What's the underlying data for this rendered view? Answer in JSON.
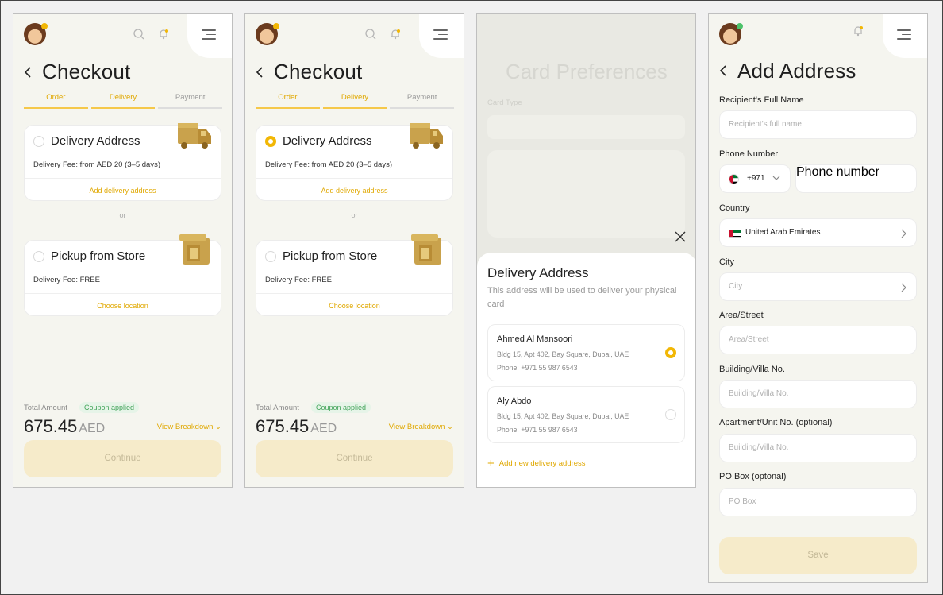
{
  "checkout": {
    "title": "Checkout",
    "steps": [
      "Order",
      "Delivery",
      "Payment"
    ],
    "delivery_card": {
      "title": "Delivery Address",
      "fee": "Delivery Fee: from AED 20 (3–5 days)",
      "link": "Add delivery address"
    },
    "or_text": "or",
    "pickup_card": {
      "title": "Pickup from Store",
      "fee": "Delivery Fee: FREE",
      "link": "Choose location"
    },
    "total_label": "Total Amount",
    "coupon": "Coupon applied",
    "amount": "675.45",
    "currency": "AED",
    "breakdown": "View Breakdown",
    "continue": "Continue"
  },
  "card_preferences": {
    "bg_title": "Card Preferences",
    "bg_label": "Card Type",
    "sheet": {
      "title": "Delivery Address",
      "subtitle": "This address will be used to deliver your physical card",
      "addresses": [
        {
          "name": "Ahmed Al Mansoori",
          "line1": "Bldg 15, Apt 402, Bay Square, Dubai, UAE",
          "phone": "Phone: +971 55 987 6543",
          "selected": true
        },
        {
          "name": "Aly Abdo",
          "line1": "Bldg 15, Apt 402, Bay Square, Dubai, UAE",
          "phone": "Phone: +971 55 987 6543",
          "selected": false
        }
      ],
      "add_new": "Add new delivery address"
    }
  },
  "add_address": {
    "title": "Add Address",
    "recipient_label": "Recipient's Full Name",
    "recipient_placeholder": "Recipient's full name",
    "phone_label": "Phone Number",
    "phone_code": "+971",
    "phone_placeholder": "Phone number",
    "country_label": "Country",
    "country_value": "United Arab Emirates",
    "city_label": "City",
    "city_placeholder": "City",
    "street_label": "Area/Street",
    "street_placeholder": "Area/Street",
    "building_label": "Building/Villa No.",
    "building_placeholder": "Building/Villa No.",
    "apartment_label": "Apartment/Unit No. (optional)",
    "apartment_placeholder": "Building/Villa No.",
    "pobox_label": "PO Box (optonal)",
    "pobox_placeholder": "PO Box",
    "save": "Save"
  },
  "colors": {
    "accent": "#f2b705",
    "accent_text": "#e0a800",
    "button_disabled": "#f6ebca",
    "screen_bg": "#f5f5ef",
    "success": "#43a45a"
  },
  "icons": [
    "avatar",
    "search-icon",
    "bell-icon",
    "menu-icon",
    "back-arrow-icon",
    "truck-icon",
    "store-icon",
    "close-icon",
    "plus-icon",
    "chevron-right-icon",
    "chevron-down-icon",
    "uae-flag-icon"
  ]
}
